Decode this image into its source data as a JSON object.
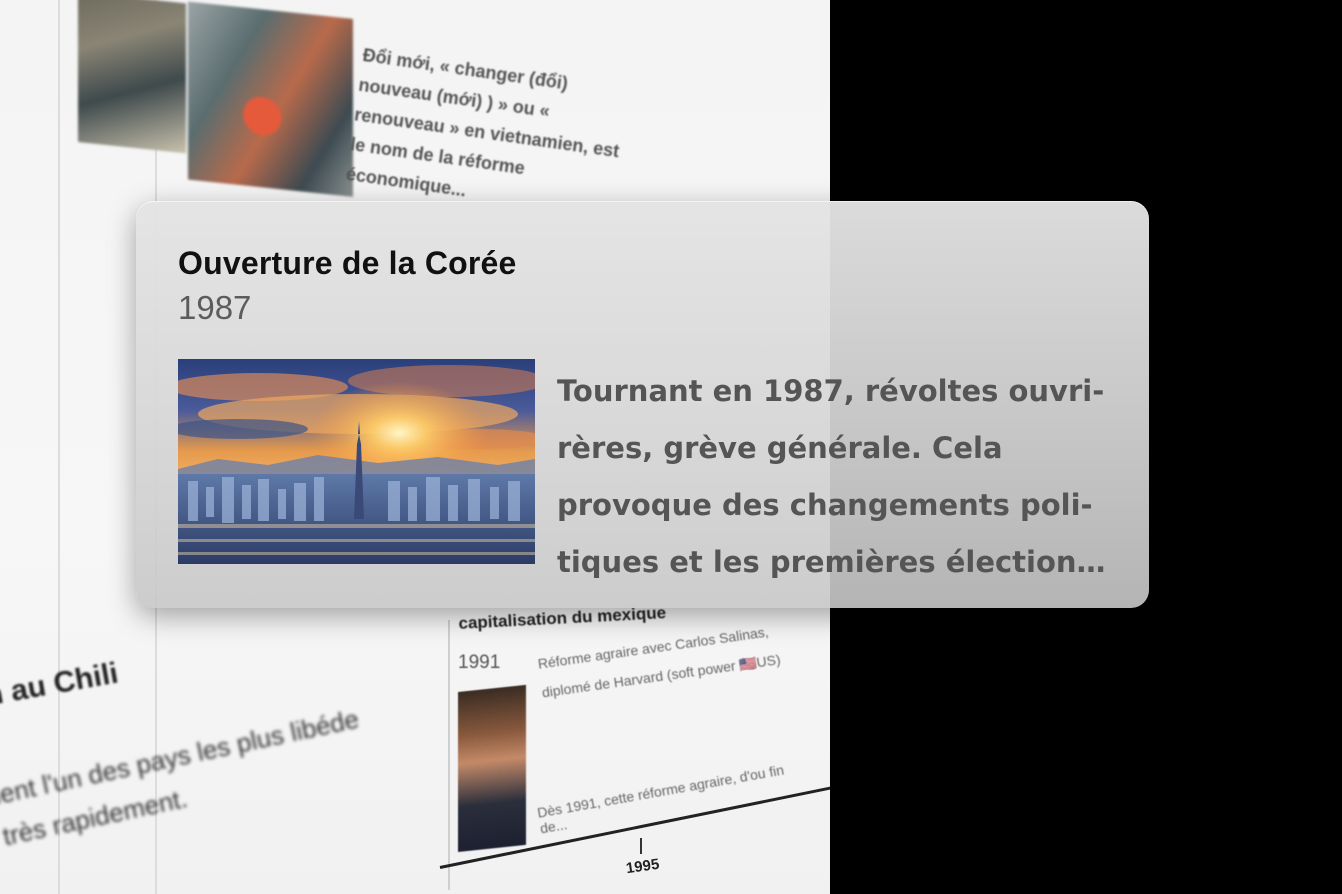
{
  "background_page": {
    "doi_moi_text": "Đổi mới, « changer (đổi) nouveau (mới) ) » ou « renouveau » en vietnamien, est le nom de la réforme économique...",
    "chili_title": "n au Chili",
    "chili_text": "ient l'un des pays les plus libéde très rapidement.",
    "mexico_title": "capitalisation du mexique",
    "mexico_year": "1991",
    "mexico_text": "Réforme agraire avec Carlos Salinas, diplomé de Harvard (soft power 🇺🇸US)",
    "mexico_text_2": "Dès 1991, cette réforme agraire, d'ou fin de...",
    "axis_tick_label": "1995"
  },
  "popup": {
    "title": "Ouverture de la Corée",
    "year": "1987",
    "description": "Tournant en 1987, révoltes ouvri-rères, grève générale. Cela provoque des changements poli-tiques et les premières élection…",
    "image_subject": "seoul-skyline-sunset"
  }
}
